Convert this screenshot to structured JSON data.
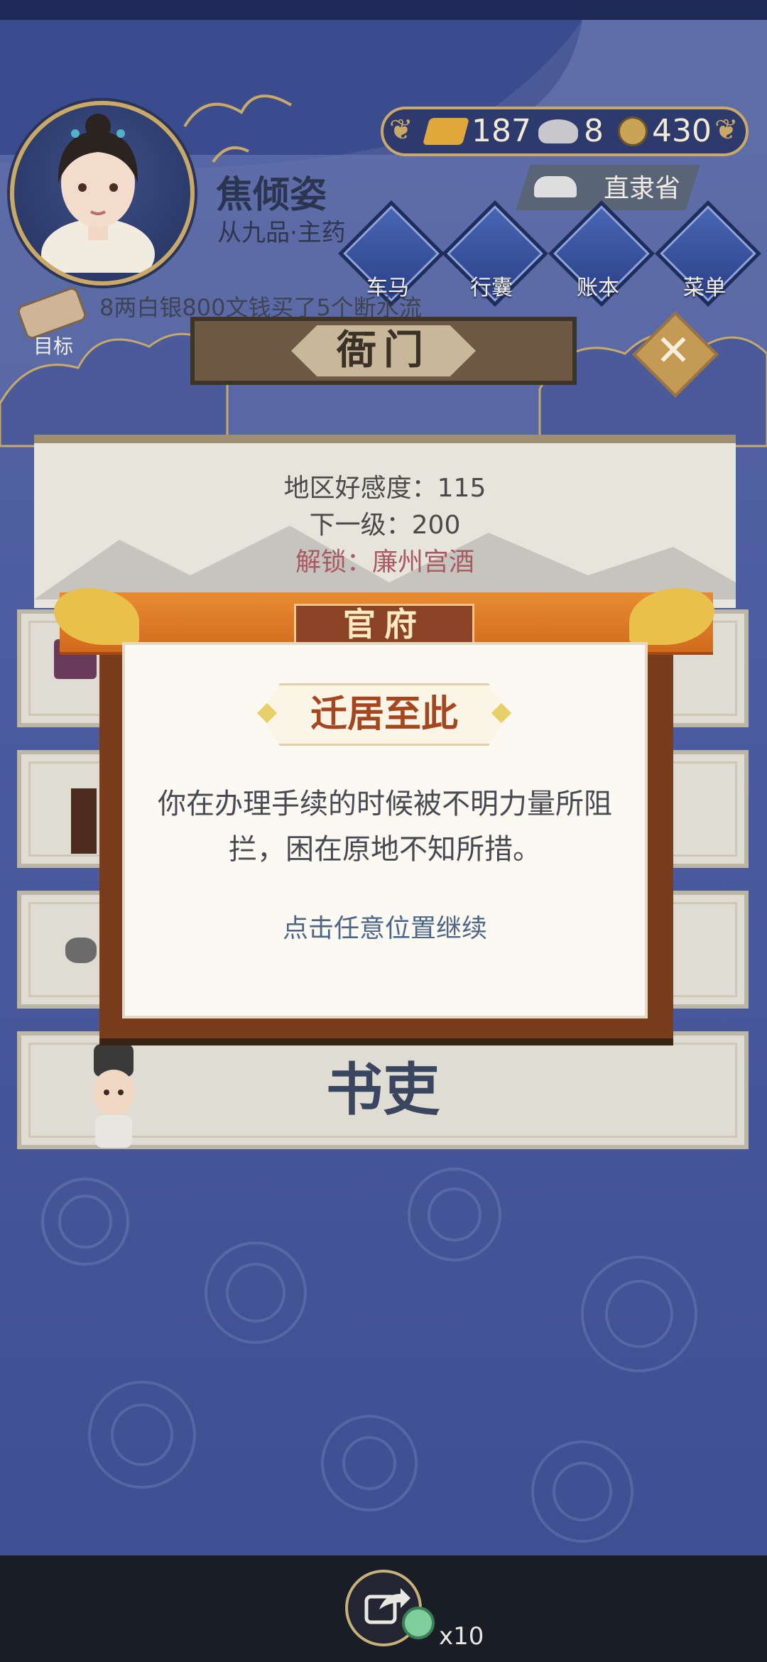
{
  "header": {
    "player_name": "焦倾姿",
    "rank": "从九品·主药",
    "location": "直隶省",
    "currency": {
      "gold": "187",
      "silver": "8",
      "copper": "430"
    }
  },
  "nav": [
    {
      "label": "车马",
      "icon": "carriage-icon"
    },
    {
      "label": "行囊",
      "icon": "bag-icon"
    },
    {
      "label": "账本",
      "icon": "ledger-icon"
    },
    {
      "label": "菜单",
      "icon": "menu-dots-icon"
    }
  ],
  "goal": {
    "label": "目标",
    "ticker": "8两白银800文钱买了5个断水流"
  },
  "plaque": {
    "title": "衙门"
  },
  "info": {
    "favor": "地区好感度：115",
    "next_level": "下一级：200",
    "unlock": "解锁：廉州宫酒"
  },
  "panels": {
    "clerk_label": "书吏"
  },
  "modal": {
    "header": "官府",
    "title": "迁居至此",
    "body": "你在办理手续的时候被不明力量所阻拦，困在原地不知所措。",
    "hint": "点击任意位置继续"
  },
  "share": {
    "count": "x10"
  },
  "colors": {
    "accent_orange": "#d06b1c",
    "modal_frame": "#7a3d1b",
    "unlock_text": "#a85a62",
    "hint_text": "#4d6587"
  }
}
